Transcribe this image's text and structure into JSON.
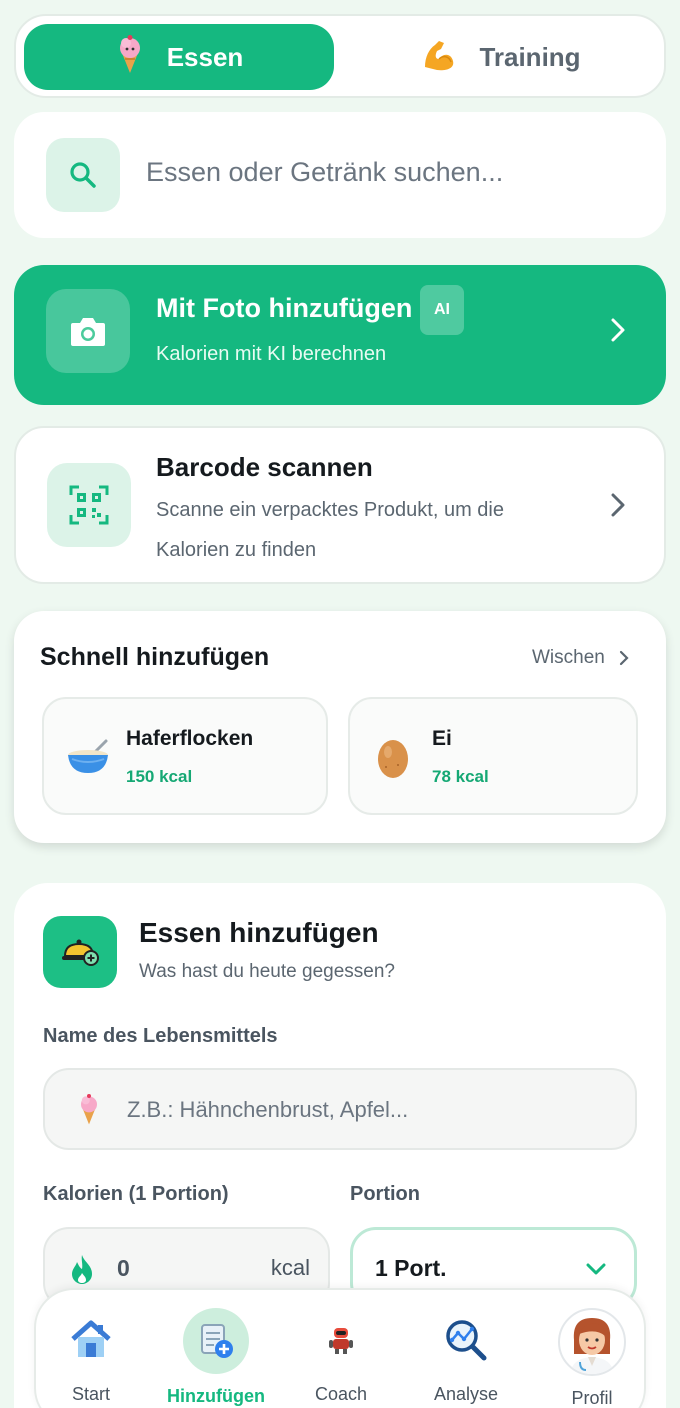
{
  "tabs": {
    "essen": {
      "label": "Essen",
      "icon": "ice-cream-icon"
    },
    "training": {
      "label": "Training",
      "icon": "flexed-biceps-icon"
    }
  },
  "search": {
    "placeholder": "Essen oder Getränk suchen...",
    "icon": "search-icon"
  },
  "photo": {
    "title": "Mit Foto hinzufügen",
    "badge": "AI",
    "subtitle": "Kalorien mit KI berechnen",
    "icon": "camera-icon"
  },
  "barcode": {
    "title": "Barcode scannen",
    "description": "Scanne ein verpacktes Produkt, um die Kalorien zu finden",
    "icon": "qr-code-icon"
  },
  "quick_add": {
    "title": "Schnell hinzufügen",
    "swipe_label": "Wischen",
    "items": [
      {
        "name": "Haferflocken",
        "kcal": "150 kcal",
        "icon": "bowl-icon"
      },
      {
        "name": "Ei",
        "kcal": "78 kcal",
        "icon": "egg-icon"
      }
    ]
  },
  "add_food": {
    "title": "Essen hinzufügen",
    "subtitle": "Was hast du heute gegessen?",
    "name_label": "Name des Lebensmittels",
    "name_placeholder": "Z.B.: Hähnchenbrust, Apfel...",
    "calories_label": "Kalorien (1 Portion)",
    "calories_value": "0",
    "calories_unit": "kcal",
    "portion_label": "Portion",
    "portion_value": "1 Port."
  },
  "nav": [
    {
      "label": "Start",
      "icon": "house-icon"
    },
    {
      "label": "Hinzufügen",
      "icon": "add-document-icon"
    },
    {
      "label": "Coach",
      "icon": "robot-icon"
    },
    {
      "label": "Analyse",
      "icon": "analytics-magnifier-icon"
    },
    {
      "label": "Profil",
      "icon": "doctor-avatar-icon"
    }
  ],
  "colors": {
    "accent": "#15b880",
    "accent_light": "#dcf3e8",
    "background": "#eef8f1"
  }
}
